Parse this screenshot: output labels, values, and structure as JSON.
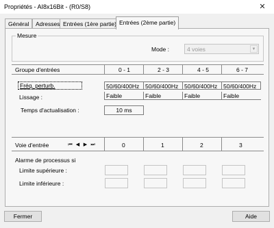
{
  "window": {
    "title": "Propriétés - AI8x16Bit - (R0/S8)"
  },
  "tabs": [
    "Général",
    "Adresses",
    "Entrées (1ère partie)",
    "Entrées (2ème partie)"
  ],
  "mesure": {
    "legend": "Mesure",
    "mode_label": "Mode :",
    "mode_value": "4 voies",
    "arrow": "▼"
  },
  "grid": {
    "group_header": "Groupe d'entrées",
    "columns": [
      "0 - 1",
      "2 - 3",
      "4 - 5",
      "6 - 7"
    ],
    "freq_label": "Fréq. perturb.",
    "freq_values": [
      "50/60/400Hz",
      "50/60/400Hz",
      "50/60/400Hz",
      "50/60/400Hz"
    ],
    "lissage_label": "Lissage :",
    "lissage_values": [
      "Faible",
      "Faible",
      "Faible",
      "Faible"
    ],
    "temps_label": "Temps d'actualisation :",
    "temps_value": "10 ms",
    "voie_label": "Voie d'entrée",
    "voie_values": [
      "0",
      "1",
      "2",
      "3"
    ]
  },
  "nav": {
    "first": "⏮",
    "prev": "◀",
    "next": "▶",
    "last": "⏭"
  },
  "alarme": {
    "title": "Alarme de processus si",
    "sup_label": "Limite supérieure :",
    "inf_label": "Limite inférieure :"
  },
  "buttons": {
    "close": "Fermer",
    "help": "Aide"
  },
  "close_glyph": "✕"
}
